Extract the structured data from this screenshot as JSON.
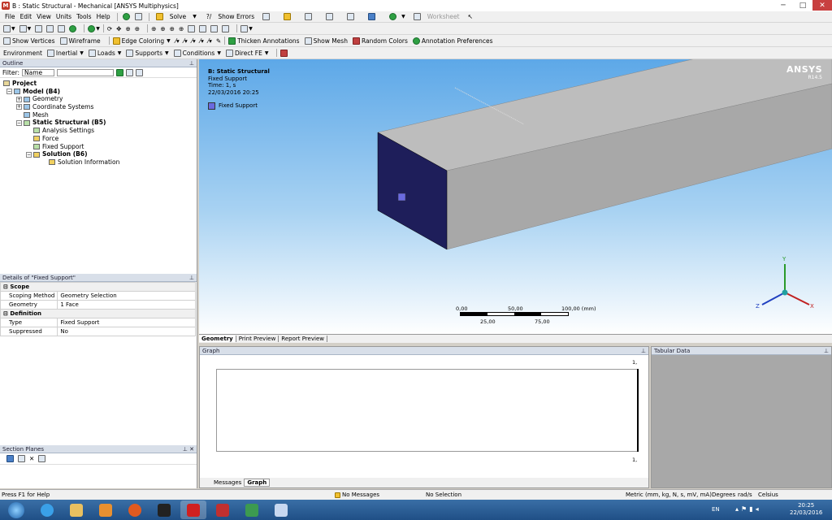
{
  "title": "B : Static Structural - Mechanical [ANSYS Multiphysics]",
  "menu": [
    "File",
    "Edit",
    "View",
    "Units",
    "Tools",
    "Help"
  ],
  "toolbar1": {
    "solve": "Solve",
    "show_errors": "Show Errors",
    "worksheet": "Worksheet"
  },
  "toolbar2": {
    "show_vertices": "Show Vertices",
    "wireframe": "Wireframe",
    "edge_coloring": "Edge Coloring",
    "thicken": "Thicken Annotations",
    "show_mesh": "Show Mesh",
    "random_colors": "Random Colors",
    "annotation_prefs": "Annotation Preferences"
  },
  "toolbar3": {
    "environment": "Environment",
    "inertial": "Inertial",
    "loads": "Loads",
    "supports": "Supports",
    "conditions": "Conditions",
    "direct_fe": "Direct FE"
  },
  "outline": {
    "title": "Outline",
    "filter_label": "Filter:",
    "filter_value": "Name",
    "tree": [
      "Project",
      "Model (B4)",
      "Geometry",
      "Coordinate Systems",
      "Mesh",
      "Static Structural (B5)",
      "Analysis Settings",
      "Force",
      "Fixed Support",
      "Solution (B6)",
      "Solution Information"
    ]
  },
  "details": {
    "title": "Details of \"Fixed Support\"",
    "rows": [
      [
        "Scope",
        ""
      ],
      [
        "Scoping Method",
        "Geometry Selection"
      ],
      [
        "Geometry",
        "1 Face"
      ],
      [
        "Definition",
        ""
      ],
      [
        "Type",
        "Fixed Support"
      ],
      [
        "Suppressed",
        "No"
      ]
    ]
  },
  "section_planes": {
    "title": "Section Planes"
  },
  "viewport": {
    "line1": "B: Static Structural",
    "line2": "Fixed Support",
    "line3": "Time: 1, s",
    "line4": "22/03/2016 20:25",
    "legend": "Fixed Support",
    "logo": "ANSYS",
    "version": "R14.5",
    "scale": {
      "t0": "0,00",
      "t1": "50,00",
      "t2": "100,00 (mm)",
      "b1": "25,00",
      "b2": "75,00"
    },
    "axes": {
      "x": "X",
      "y": "Y",
      "z": "Z"
    }
  },
  "tabs": [
    "Geometry",
    "Print Preview",
    "Report Preview"
  ],
  "graph": {
    "title": "Graph",
    "top": "1,",
    "bottom": "1,",
    "tabs": [
      "Messages",
      "Graph"
    ]
  },
  "tabular": {
    "title": "Tabular Data"
  },
  "status": {
    "help": "Press F1 for Help",
    "messages": "No Messages",
    "selection": "No Selection",
    "units": "Metric (mm, kg, N, s, mV, mA)",
    "angle": "Degrees",
    "rate": "rad/s",
    "temp": "Celsius"
  },
  "taskbar": {
    "lang": "EN",
    "time": "20:25",
    "date": "22/03/2016"
  },
  "colors": {
    "fixed_face": "#1e1e5a",
    "legend": "#6a6ae0",
    "body": "#a8a8a8"
  }
}
